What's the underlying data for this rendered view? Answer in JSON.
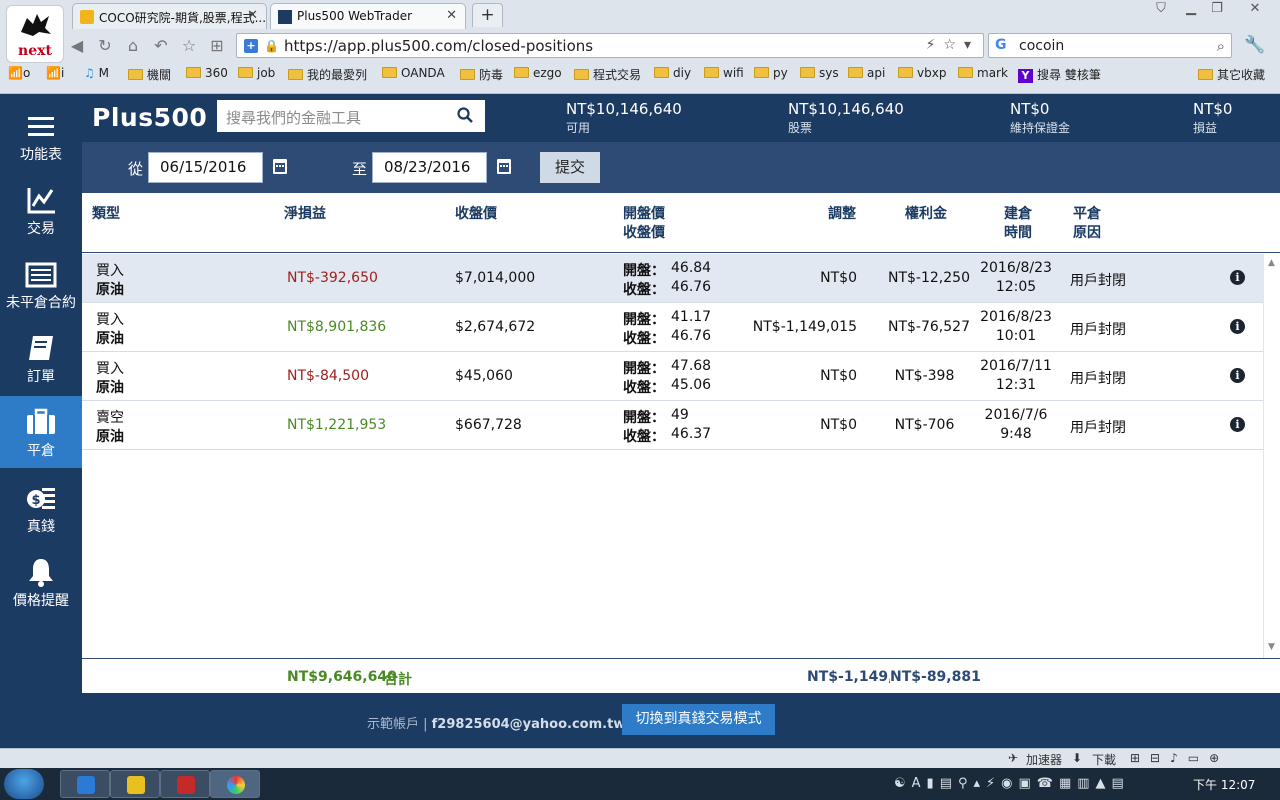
{
  "browser": {
    "logo_text": "next",
    "tabs": [
      {
        "title": "COCO研究院-期貨,股票,程式..."
      },
      {
        "title": "Plus500 WebTrader"
      }
    ],
    "new_tab": "+",
    "url": "https://app.plus500.com/closed-positions",
    "search_query": "cocoin",
    "search_engine_glyph": "G",
    "bookmarks": [
      "o",
      "i",
      "M",
      "機關",
      "360",
      "job",
      "我的最愛列",
      "OANDA",
      "防毒",
      "ezgo",
      "程式交易",
      "diy",
      "wifi",
      "py",
      "sys",
      "api",
      "vbxp",
      "mark",
      "搜尋 雙核筆",
      "其它收藏"
    ]
  },
  "sidebar": {
    "items": [
      {
        "label": "功能表",
        "icon": "menu-icon"
      },
      {
        "label": "交易",
        "icon": "chart-icon"
      },
      {
        "label": "未平倉合約",
        "icon": "open-positions-icon"
      },
      {
        "label": "訂單",
        "icon": "orders-icon"
      },
      {
        "label": "平倉",
        "icon": "briefcase-icon"
      },
      {
        "label": "真錢",
        "icon": "money-icon"
      },
      {
        "label": "價格提醒",
        "icon": "bell-icon"
      }
    ],
    "active_index": 4
  },
  "header": {
    "brand": "Plus500",
    "search_placeholder": "搜尋我們的金融工具",
    "stats": [
      {
        "value": "NT$10,146,640",
        "label": "可用"
      },
      {
        "value": "NT$10,146,640",
        "label": "股票"
      },
      {
        "value": "NT$0",
        "label": "維持保證金"
      },
      {
        "value": "NT$0",
        "label": "損益"
      }
    ]
  },
  "filter": {
    "from_label": "從",
    "from_date": "06/15/2016",
    "to_label": "至",
    "to_date": "08/23/2016",
    "submit_label": "提交"
  },
  "table": {
    "headers": {
      "type": "類型",
      "net_pnl": "淨損益",
      "close_price": "收盤價",
      "open_close_1": "開盤價",
      "open_close_2": "收盤價",
      "adjust": "調整",
      "premium": "權利金",
      "open_time_1": "建倉",
      "open_time_2": "時間",
      "close_reason_1": "平倉",
      "close_reason_2": "原因"
    },
    "open_label": "開盤：",
    "close_label": "收盤：",
    "rows": [
      {
        "direction": "買入",
        "instrument": "原油",
        "net_pnl": "NT$-392,650",
        "pnl_sign": "neg",
        "close_amount": "$7,014,000",
        "open_price": "46.84",
        "close_price": "46.76",
        "adjust": "NT$0",
        "premium": "NT$-12,250",
        "date": "2016/8/23",
        "time": "12:05",
        "reason": "用戶封閉"
      },
      {
        "direction": "買入",
        "instrument": "原油",
        "net_pnl": "NT$8,901,836",
        "pnl_sign": "pos",
        "close_amount": "$2,674,672",
        "open_price": "41.17",
        "close_price": "46.76",
        "adjust": "NT$-1,149,015",
        "premium": "NT$-76,527",
        "date": "2016/8/23",
        "time": "10:01",
        "reason": "用戶封閉"
      },
      {
        "direction": "買入",
        "instrument": "原油",
        "net_pnl": "NT$-84,500",
        "pnl_sign": "neg",
        "close_amount": "$45,060",
        "open_price": "47.68",
        "close_price": "45.06",
        "adjust": "NT$0",
        "premium": "NT$-398",
        "date": "2016/7/11",
        "time": "12:31",
        "reason": "用戶封閉"
      },
      {
        "direction": "賣空",
        "instrument": "原油",
        "net_pnl": "NT$1,221,953",
        "pnl_sign": "pos",
        "close_amount": "$667,728",
        "open_price": "49",
        "close_price": "46.37",
        "adjust": "NT$0",
        "premium": "NT$-706",
        "date": "2016/7/6",
        "time": "9:48",
        "reason": "用戶封閉"
      }
    ],
    "selected_row": 0
  },
  "totals": {
    "net_pnl": "NT$9,646,640",
    "total_label": "合計",
    "adjust": "NT$-1,149,015",
    "premium": "NT$-89,881"
  },
  "footer": {
    "account_label": "示範帳戶 |",
    "email": "f29825604@yahoo.com.tw",
    "switch_label": "切換到真錢交易模式"
  },
  "statusbar": {
    "accelerator": "加速器",
    "download": "下載"
  },
  "taskbar": {
    "clock": "下午 12:07"
  },
  "colors": {
    "navy": "#1c3b63",
    "filter_bar": "#2d4b74",
    "accent_blue": "#2e7cc8",
    "loss_red": "#a02020",
    "profit_green": "#4a8a26"
  }
}
